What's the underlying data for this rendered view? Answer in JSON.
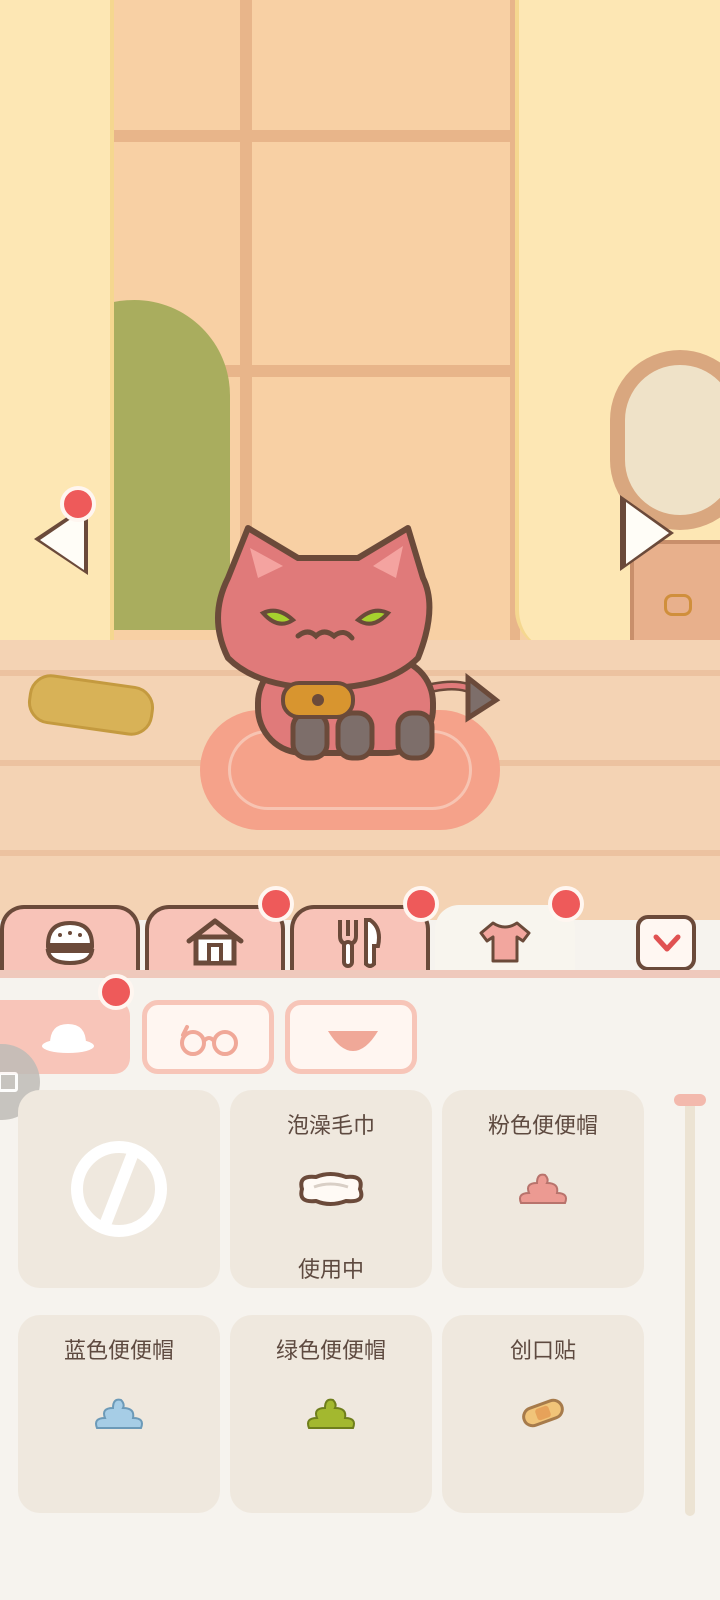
{
  "scene": {
    "pet_name": "",
    "notification_dots": true
  },
  "tabs": [
    {
      "name": "tab-food-bowl",
      "icon": "burger-icon"
    },
    {
      "name": "tab-home",
      "icon": "house-icon"
    },
    {
      "name": "tab-food",
      "icon": "fork-knife-icon"
    },
    {
      "name": "tab-clothing",
      "icon": "shirt-icon",
      "active": true
    }
  ],
  "subtabs": [
    {
      "icon": "hat-icon",
      "active": true
    },
    {
      "icon": "glasses-icon"
    },
    {
      "icon": "collar-icon"
    }
  ],
  "items": [
    {
      "name": "",
      "status": "",
      "icon": "none-icon"
    },
    {
      "name": "泡澡毛巾",
      "status": "使用中",
      "icon": "towel-icon"
    },
    {
      "name": "粉色便便帽",
      "status": "",
      "icon": "poop-hat-pink-icon"
    },
    {
      "name": "蓝色便便帽",
      "status": "",
      "icon": "poop-hat-blue-icon"
    },
    {
      "name": "绿色便便帽",
      "status": "",
      "icon": "poop-hat-green-icon"
    },
    {
      "name": "创口贴",
      "status": "",
      "icon": "bandage-icon"
    }
  ],
  "colors": {
    "accent": "#ee5a5a",
    "tab_pink": "#f8c3b8",
    "outline": "#6b4a3a",
    "panel": "#f6f3ee",
    "card": "#efe8de"
  }
}
